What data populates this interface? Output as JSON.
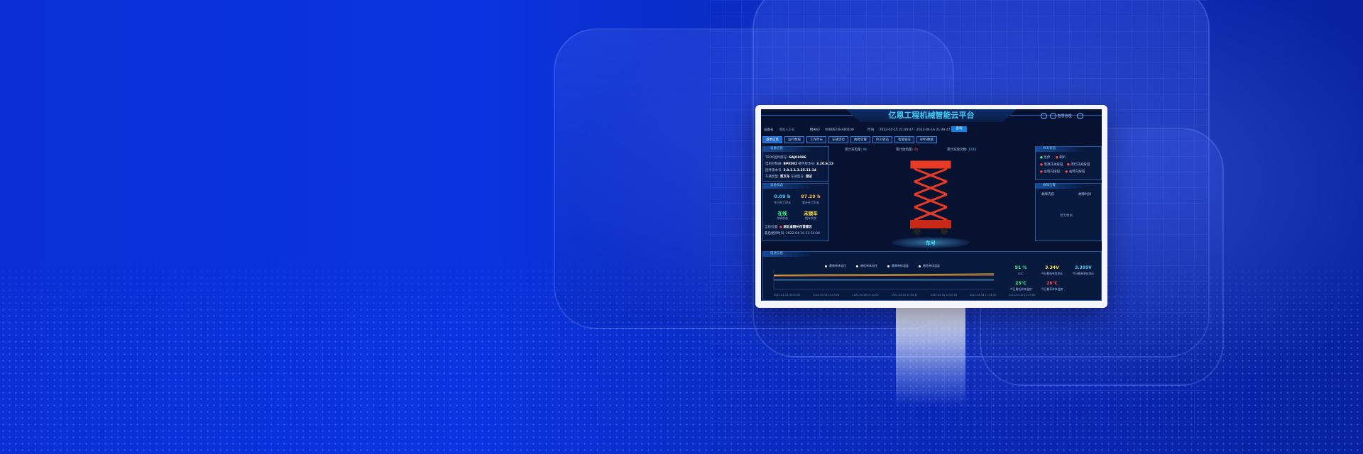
{
  "app": {
    "title": "亿恩工程机械智能云平台",
    "user": "智慧管理"
  },
  "query": {
    "device_no_label": "设备号",
    "device_no_value": "请输入车号",
    "gateway_label": "网关ID",
    "gateway_value": "0080624H480100",
    "time_label": "时间",
    "time_value": "2022-04-15 21:49:47 - 2022-04-16 21:49:47",
    "search_label": "查询"
  },
  "tabs": [
    "基本信息",
    "运行数据",
    "工作时长",
    "车辆定位",
    "故障告警",
    "PCU状态",
    "智能锁车",
    "BMS数据"
  ],
  "device_info": {
    "heading": "设备信息",
    "items": [
      {
        "label": "TBOX固件版号:",
        "value": "GAJ01086"
      },
      {
        "label": "电机控制器:",
        "value": "BPK002",
        "label2": "硬件版本号:",
        "value2": "3.20.6.13"
      },
      {
        "label": "固件版本号:",
        "value": "3.0.2.1.3.25.11.14"
      },
      {
        "label": "车辆类型:",
        "value": "剪叉车",
        "label2": "车辆型号:",
        "value2": "测试"
      }
    ]
  },
  "device_status": {
    "heading": "设备状态",
    "today_hours": "0.09 h",
    "today_hours_label": "今日开工时长",
    "total_hours": "87.29 h",
    "total_hours_label": "累计开工时长",
    "online": "在线",
    "online_label": "车辆状态",
    "lock": "未锁车",
    "lock_label": "锁车状态",
    "location_label": "当前位置:",
    "location_value": "湖北省随州市曾都区",
    "update_label": "最后更新时间:",
    "update_value": "2022-04-16 21:50:00"
  },
  "metrics": [
    {
      "label": "累计充电量:",
      "value": "Ah"
    },
    {
      "label": "累计放电量:",
      "value": "Ah"
    },
    {
      "label": "累计充放次数:",
      "value": "1226"
    }
  ],
  "lift_label": "车号",
  "pcu": {
    "heading": "PCU状态",
    "items": [
      "急停",
      "喇叭",
      "电源开关按钮",
      "爬行开关按钮",
      "左转向按钮",
      "右转向按钮"
    ]
  },
  "fault": {
    "heading": "故障告警",
    "col1": "故障内容",
    "col2": "故障时间",
    "empty": "暂无数据"
  },
  "battery": {
    "heading": "电池信息",
    "legend": [
      "最高单体电压",
      "最低单体电压",
      "最高单体温度",
      "最低单体温度"
    ],
    "time_ticks": [
      "2022-04-16 00:00:00",
      "2022-04-16 10:03:26",
      "2022-04-16 13:02:00",
      "2022-04-16 14:05:47",
      "2022-04-16 15:05:16",
      "2022-04-16 17:14:50",
      "2022-04-16 21:29:00"
    ],
    "stats": [
      {
        "value": "91 %",
        "label": "SOC",
        "color": "#36ff8a"
      },
      {
        "value": "3.34V",
        "label": "今日最低单体电压",
        "color": "#ffe23a"
      },
      {
        "value": "3.395V",
        "label": "今日最高单体电压",
        "color": "#3fd2ff"
      },
      {
        "value": "23℃",
        "label": "今日最低单体温度",
        "color": "#36ff8a"
      },
      {
        "value": "26℃",
        "label": "今日最高单体温度",
        "color": "#ff4a4a"
      }
    ]
  },
  "colors": {
    "accent": "#3fd2ff",
    "background": "#0a2fd6",
    "lift": "#e83a24"
  }
}
